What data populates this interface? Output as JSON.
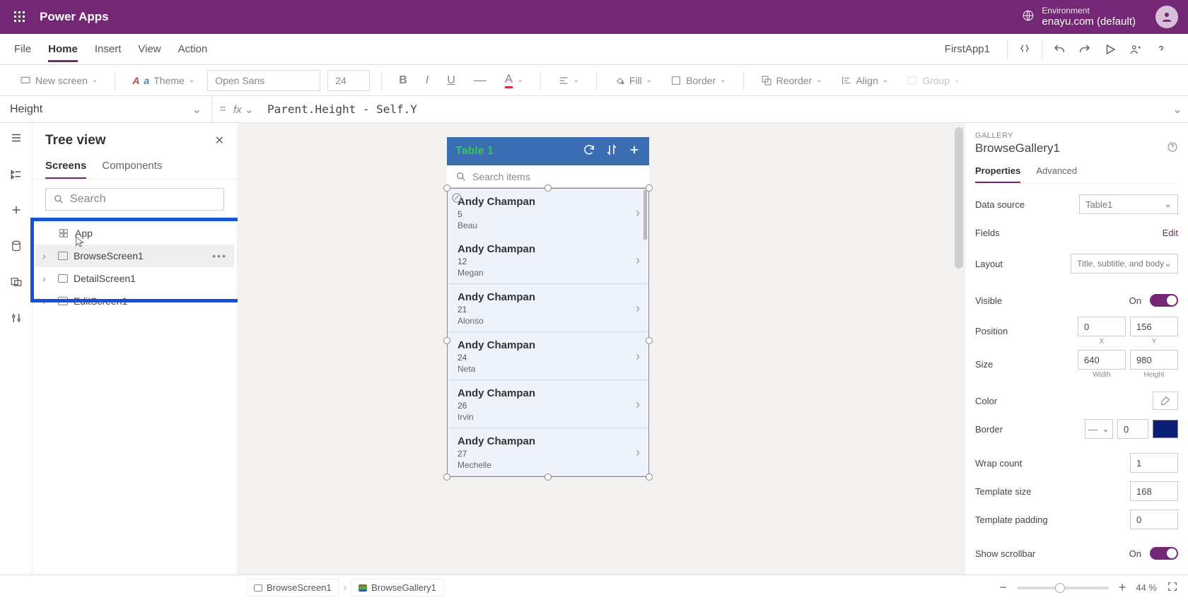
{
  "topbar": {
    "app_name": "Power Apps",
    "env_label": "Environment",
    "env_value": "enayu.com (default)"
  },
  "menu": {
    "items": [
      "File",
      "Home",
      "Insert",
      "View",
      "Action"
    ],
    "active": "Home",
    "app_name": "FirstApp1"
  },
  "toolbar": {
    "new_screen": "New screen",
    "theme": "Theme",
    "font": "Open Sans",
    "font_size": "24",
    "fill": "Fill",
    "border": "Border",
    "reorder": "Reorder",
    "align": "Align",
    "group": "Group"
  },
  "formula": {
    "property": "Height",
    "expr": "Parent.Height - Self.Y"
  },
  "tree": {
    "title": "Tree view",
    "tabs": [
      "Screens",
      "Components"
    ],
    "search_placeholder": "Search",
    "app": "App",
    "screens": [
      "BrowseScreen1",
      "DetailScreen1",
      "EditScreen1"
    ]
  },
  "phone": {
    "title": "Table 1",
    "search_placeholder": "Search items",
    "items": [
      {
        "title": "Andy Champan",
        "sub": "5",
        "body": "Beau"
      },
      {
        "title": "Andy Champan",
        "sub": "12",
        "body": "Megan"
      },
      {
        "title": "Andy Champan",
        "sub": "21",
        "body": "Alonso"
      },
      {
        "title": "Andy Champan",
        "sub": "24",
        "body": "Neta"
      },
      {
        "title": "Andy Champan",
        "sub": "26",
        "body": "Irvin"
      },
      {
        "title": "Andy Champan",
        "sub": "27",
        "body": "Mechelle"
      }
    ]
  },
  "props": {
    "category": "GALLERY",
    "name": "BrowseGallery1",
    "tabs": [
      "Properties",
      "Advanced"
    ],
    "data_source_label": "Data source",
    "data_source_value": "Table1",
    "fields_label": "Fields",
    "edit": "Edit",
    "layout_label": "Layout",
    "layout_value": "Title, subtitle, and body",
    "visible_label": "Visible",
    "visible_value": "On",
    "position_label": "Position",
    "pos_x": "0",
    "pos_y": "156",
    "x_label": "X",
    "y_label": "Y",
    "size_label": "Size",
    "width": "640",
    "height": "980",
    "width_label": "Width",
    "height_label": "Height",
    "color_label": "Color",
    "border_label": "Border",
    "border_width": "0",
    "wrap_label": "Wrap count",
    "wrap_value": "1",
    "template_size_label": "Template size",
    "template_size": "168",
    "template_padding_label": "Template padding",
    "template_padding": "0",
    "scrollbar_label": "Show scrollbar",
    "scrollbar_value": "On"
  },
  "status": {
    "crumb1": "BrowseScreen1",
    "crumb2": "BrowseGallery1",
    "zoom": "44 %"
  }
}
